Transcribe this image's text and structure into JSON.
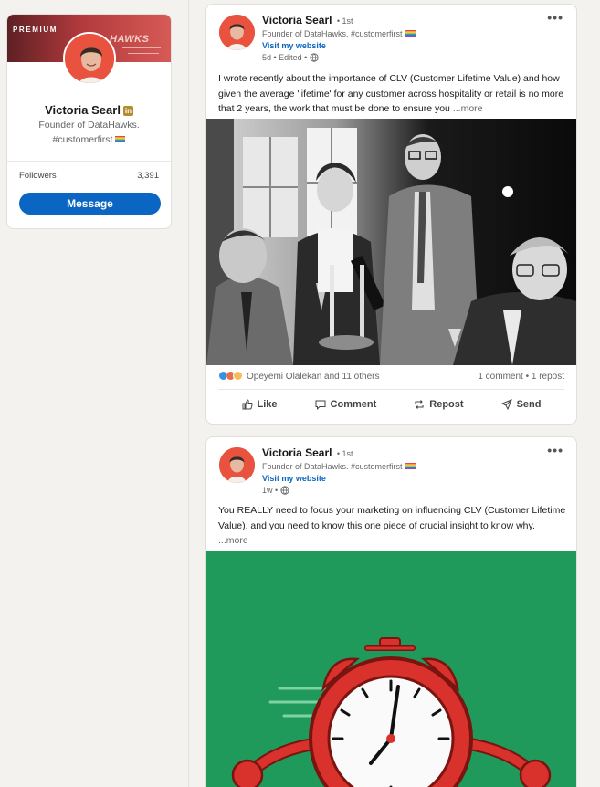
{
  "profile": {
    "banner_label": "PREMIUM",
    "banner_brand": "HAWKS",
    "name": "Victoria Searl",
    "headline_line1": "Founder of DataHawks.",
    "headline_line2": "#customerfirst",
    "followers_label": "Followers",
    "followers_count": "3,391",
    "message_button": "Message"
  },
  "posts": [
    {
      "author": "Victoria Searl",
      "degree": "• 1st",
      "headline": "Founder of DataHawks. #customerfirst",
      "website_link": "Visit my website",
      "meta": "5d • Edited •",
      "text": "I wrote recently about the importance of CLV (Customer Lifetime Value) and how given the average 'lifetime' for any customer across hospitality or retail is no more that 2 years, the work that must be done to ensure you ",
      "see_more": "...more",
      "reactions": "Opeyemi Olalekan and 11 others",
      "comments_reposts": "1 comment • 1 repost",
      "actions": {
        "like": "Like",
        "comment": "Comment",
        "repost": "Repost",
        "send": "Send"
      }
    },
    {
      "author": "Victoria Searl",
      "degree": "• 1st",
      "headline": "Founder of DataHawks. #customerfirst",
      "website_link": "Visit my website",
      "meta": "1w •",
      "text": "You REALLY need to focus your marketing on influencing CLV (Customer Lifetime Value), and you need to know this one piece of crucial insight to know why. ",
      "see_more": "...more"
    }
  ],
  "colors": {
    "accent": "#0a66c2",
    "banner": "#b23a3c",
    "illustration_bg": "#1f9a5a",
    "clock_red": "#d9312b"
  },
  "icons": [
    "linkedin-badge-icon",
    "rainbow-flag-icon",
    "globe-icon",
    "more-options-icon",
    "like-icon",
    "comment-icon",
    "repost-icon",
    "send-icon",
    "reaction-icons"
  ]
}
